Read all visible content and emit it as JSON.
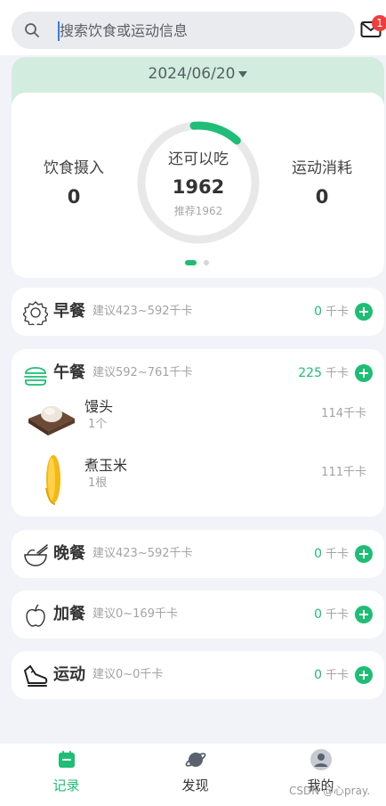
{
  "search": {
    "placeholder": "搜索饮食或运动信息"
  },
  "mail": {
    "badge_count": "1"
  },
  "summary": {
    "date": "2024/06/20",
    "intake_label": "饮食摄入",
    "intake_value": "0",
    "remaining_label": "还可以吃",
    "remaining_value": "1962",
    "recommend_text": "推荐1962",
    "burn_label": "运动消耗",
    "burn_value": "0"
  },
  "meals": [
    {
      "name": "早餐",
      "suggestion": "建议423~592千卡",
      "kcal": "0",
      "unit": "千卡",
      "icon": "breakfast-icon"
    },
    {
      "name": "午餐",
      "suggestion": "建议592~761千卡",
      "kcal": "225",
      "unit": "千卡",
      "icon": "burger-icon",
      "items": [
        {
          "name": "馒头",
          "qty": "1个",
          "kcal": "114千卡",
          "icon": "steamed-bun-image"
        },
        {
          "name": "煮玉米",
          "qty": "1根",
          "kcal": "111千卡",
          "icon": "corn-image"
        }
      ]
    },
    {
      "name": "晚餐",
      "suggestion": "建议423~592千卡",
      "kcal": "0",
      "unit": "千卡",
      "icon": "rice-bowl-icon"
    },
    {
      "name": "加餐",
      "suggestion": "建议0~169千卡",
      "kcal": "0",
      "unit": "千卡",
      "icon": "apple-icon"
    },
    {
      "name": "运动",
      "suggestion": "建议0~0千卡",
      "kcal": "0",
      "unit": "千卡",
      "icon": "sneaker-icon"
    }
  ],
  "tabs": [
    {
      "label": "记录",
      "icon": "calendar-icon",
      "active": true
    },
    {
      "label": "发现",
      "icon": "planet-icon",
      "active": false
    },
    {
      "label": "我的",
      "icon": "user-icon",
      "active": false
    }
  ],
  "watermark": "CSDN @心pray.",
  "colors": {
    "accent": "#1fbd75",
    "badge": "#f23b3b",
    "header_band": "#d3ece0"
  }
}
